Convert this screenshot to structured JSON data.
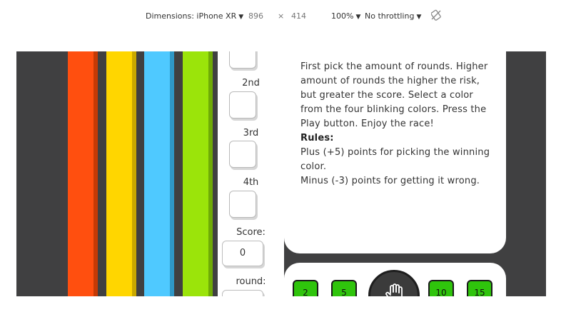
{
  "devtools": {
    "device_label": "Dimensions: iPhone XR",
    "width": "896",
    "times": "×",
    "height": "414",
    "zoom": "100%",
    "throttle": "No throttling",
    "rotate_icon": "rotate-icon"
  },
  "lanes": [
    {
      "color": "#ff4f0f",
      "shade": "#c53a05"
    },
    {
      "color": "#ffd600",
      "shade": "#c9a800"
    },
    {
      "color": "#4fc9ff",
      "shade": "#2f97c6"
    },
    {
      "color": "#9be40a",
      "shade": "#6fab06"
    }
  ],
  "standings": {
    "second_label": "2nd",
    "third_label": "3rd",
    "fourth_label": "4th",
    "score_label": "Score:",
    "score_value": "0",
    "round_label": "round:"
  },
  "instructions": {
    "p1": "First pick the amount of rounds. Higher amount of rounds the higher the risk, but greater the score. Select a color from the four blinking colors. Press the Play button. Enjoy the race!",
    "rules_title": "Rules:",
    "rule1": "Plus (+5) points for picking the winning color.",
    "rule2": "Minus (-3) points for getting it wrong."
  },
  "rounds": {
    "options": [
      "2",
      "5",
      "10",
      "15"
    ],
    "button_color": "#2fc40c",
    "play_icon": "hand-icon"
  }
}
